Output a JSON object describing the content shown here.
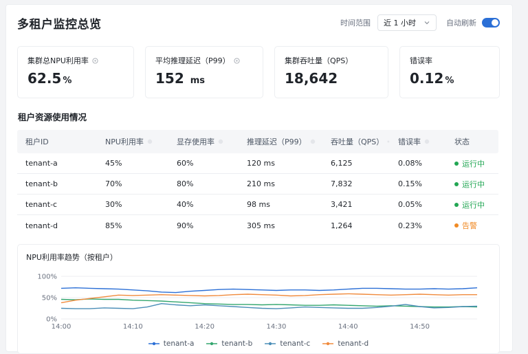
{
  "header": {
    "title": "多租户监控总览",
    "time_range_label": "时间范围",
    "time_range_value": "近 1 小时",
    "auto_refresh_label": "自动刷新",
    "auto_refresh_on": true
  },
  "kpis": [
    {
      "label": "集群总NPU利用率",
      "value": "62.5",
      "unit": "%",
      "has_info": true
    },
    {
      "label": "平均推理延迟（P99）",
      "value": "152",
      "unit": "ms",
      "has_info": true
    },
    {
      "label": "集群吞吐量（QPS）",
      "value": "18,642",
      "unit": "",
      "has_info": false
    },
    {
      "label": "错误率",
      "value": "0.12",
      "unit": "%",
      "has_info": false
    }
  ],
  "table": {
    "title": "租户资源使用情况",
    "columns": [
      "租户ID",
      "NPU利用率",
      "显存使用率",
      "推理延迟（P99）",
      "吞吐量（QPS）",
      "错误率",
      "状态"
    ],
    "rows": [
      {
        "id": "tenant-a",
        "npu": "45%",
        "mem": "60%",
        "latency": "120 ms",
        "qps": "6,125",
        "err": "0.08%",
        "status": "运行中",
        "status_color": "#22a653"
      },
      {
        "id": "tenant-b",
        "npu": "70%",
        "mem": "80%",
        "latency": "210 ms",
        "qps": "7,832",
        "err": "0.15%",
        "status": "运行中",
        "status_color": "#22a653"
      },
      {
        "id": "tenant-c",
        "npu": "30%",
        "mem": "40%",
        "latency": "98 ms",
        "qps": "3,421",
        "err": "0.05%",
        "status": "运行中",
        "status_color": "#22a653"
      },
      {
        "id": "tenant-d",
        "npu": "85%",
        "mem": "90%",
        "latency": "305 ms",
        "qps": "1,264",
        "err": "0.23%",
        "status": "告警",
        "status_color": "#f08a24"
      }
    ]
  },
  "chart_data": {
    "type": "line",
    "title": "NPU利用率趋势（按租户）",
    "xlabel": "",
    "ylabel": "",
    "x_ticks": [
      "14:00",
      "14:10",
      "14:20",
      "14:30",
      "14:40",
      "14:50"
    ],
    "y_ticks": [
      "100%",
      "50%",
      "0%"
    ],
    "ylim": [
      0,
      100
    ],
    "xlim": [
      0,
      58
    ],
    "grid": true,
    "legend_position": "bottom",
    "x": [
      0,
      2,
      4,
      6,
      8,
      10,
      12,
      14,
      16,
      18,
      20,
      22,
      24,
      26,
      28,
      30,
      32,
      34,
      36,
      38,
      40,
      42,
      44,
      46,
      48,
      50,
      52,
      54,
      56,
      58
    ],
    "series": [
      {
        "name": "tenant-a",
        "color": "#2b6fd6",
        "values": [
          72,
          73,
          72,
          71,
          70,
          68,
          66,
          63,
          62,
          65,
          67,
          69,
          70,
          69,
          68,
          67,
          68,
          68,
          67,
          68,
          70,
          72,
          72,
          71,
          70,
          70,
          71,
          70,
          71,
          73
        ]
      },
      {
        "name": "tenant-b",
        "color": "#33a66e",
        "values": [
          46,
          45,
          47,
          46,
          46,
          44,
          43,
          42,
          40,
          38,
          36,
          35,
          34,
          34,
          33,
          34,
          33,
          32,
          32,
          33,
          32,
          31,
          30,
          31,
          30,
          29,
          28,
          28,
          29,
          28
        ]
      },
      {
        "name": "tenant-c",
        "color": "#4a8db7",
        "values": [
          25,
          24,
          24,
          26,
          25,
          24,
          28,
          36,
          33,
          31,
          33,
          31,
          29,
          27,
          25,
          24,
          26,
          28,
          27,
          26,
          25,
          25,
          27,
          30,
          34,
          29,
          26,
          27,
          29,
          30
        ]
      },
      {
        "name": "tenant-d",
        "color": "#f08a3c",
        "values": [
          38,
          44,
          48,
          52,
          56,
          55,
          56,
          57,
          56,
          55,
          54,
          55,
          57,
          58,
          57,
          56,
          54,
          55,
          57,
          58,
          59,
          58,
          57,
          56,
          57,
          58,
          57,
          56,
          57,
          57
        ]
      }
    ]
  }
}
